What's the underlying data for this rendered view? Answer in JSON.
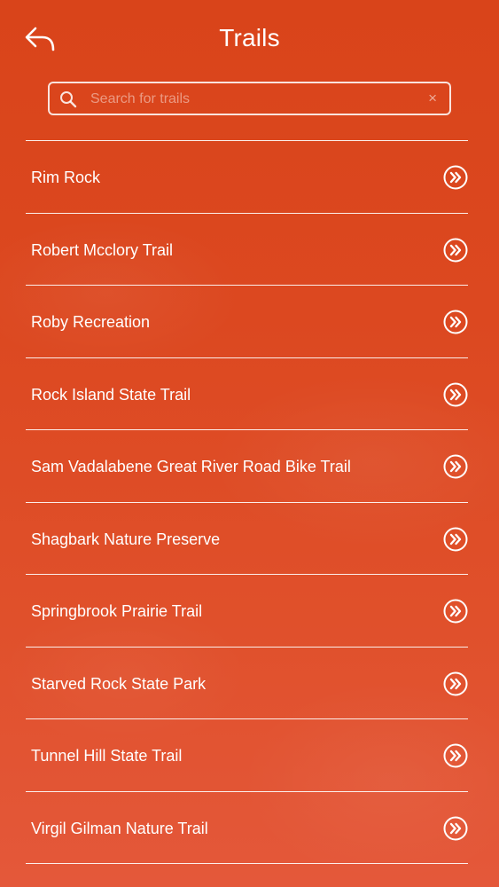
{
  "header": {
    "title": "Trails",
    "back_icon": "back-arrow-icon"
  },
  "search": {
    "placeholder": "Search for trails",
    "value": "",
    "search_icon": "search-icon",
    "clear_icon": "clear-icon",
    "clear_glyph": "×"
  },
  "trails": [
    {
      "name": "Rim Rock"
    },
    {
      "name": "Robert Mcclory Trail"
    },
    {
      "name": "Roby Recreation"
    },
    {
      "name": "Rock Island State Trail"
    },
    {
      "name": "Sam Vadalabene Great River Road Bike Trail"
    },
    {
      "name": "Shagbark Nature Preserve"
    },
    {
      "name": "Springbrook Prairie Trail"
    },
    {
      "name": "Starved Rock State Park"
    },
    {
      "name": "Tunnel Hill State Trail"
    },
    {
      "name": "Virgil Gilman Nature Trail"
    }
  ],
  "colors": {
    "background": "#dc4820",
    "foreground": "#ffffff"
  }
}
